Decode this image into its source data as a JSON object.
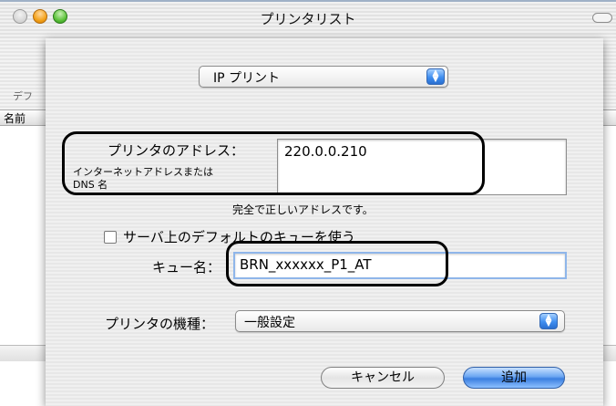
{
  "window": {
    "title": "プリンタリスト"
  },
  "background": {
    "left_label": "デフ",
    "list_column_name": "名前"
  },
  "sheet": {
    "connection_type": "IP プリント",
    "address_label": "プリンタのアドレス：",
    "address_hint_line1": "インターネットアドレスまたは",
    "address_hint_line2": "DNS 名",
    "address_value": "220.0.0.210",
    "address_status": "完全で正しいアドレスです。",
    "default_queue_label": "サーバ上のデフォルトのキューを使う",
    "default_queue_checked": false,
    "queue_label": "キュー名：",
    "queue_value": "BRN_xxxxxx_P1_AT",
    "model_label": "プリンタの機種：",
    "model_value": "一般設定",
    "cancel_label": "キャンセル",
    "add_label": "追加"
  },
  "icons": {
    "popup_stepper": "up-down-arrows-icon",
    "window_controls": [
      "close-light",
      "minimize-light",
      "zoom-light"
    ]
  },
  "colors": {
    "accent": "#3b7fe0",
    "focus_ring": "#8fb6ea"
  }
}
